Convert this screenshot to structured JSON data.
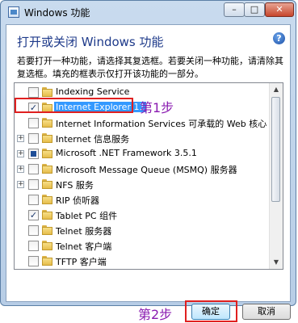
{
  "window": {
    "title": "Windows 功能",
    "controls": {
      "minimize": "–",
      "maximize": "□",
      "close": "✕"
    }
  },
  "dialog": {
    "heading": "打开或关闭 Windows 功能",
    "help_icon": "?",
    "description": "若要打开一种功能，请选择其复选框。若要关闭一种功能，请清除其复选框。填充的框表示仅打开该功能的一部分。"
  },
  "features": [
    {
      "label": "Indexing Service",
      "expandable": false,
      "state": "unchecked"
    },
    {
      "label": "Internet Explorer 11",
      "expandable": false,
      "state": "checked",
      "selected": true
    },
    {
      "label": "Internet Information Services 可承载的 Web 核心",
      "expandable": false,
      "state": "unchecked"
    },
    {
      "label": "Internet 信息服务",
      "expandable": true,
      "state": "unchecked"
    },
    {
      "label": "Microsoft .NET Framework 3.5.1",
      "expandable": true,
      "state": "partial"
    },
    {
      "label": "Microsoft Message Queue (MSMQ) 服务器",
      "expandable": true,
      "state": "unchecked"
    },
    {
      "label": "NFS 服务",
      "expandable": true,
      "state": "unchecked"
    },
    {
      "label": "RIP 侦听器",
      "expandable": false,
      "state": "unchecked"
    },
    {
      "label": "Tablet PC 组件",
      "expandable": false,
      "state": "checked"
    },
    {
      "label": "Telnet 服务器",
      "expandable": false,
      "state": "unchecked"
    },
    {
      "label": "Telnet 客户端",
      "expandable": false,
      "state": "unchecked"
    },
    {
      "label": "TFTP 客户端",
      "expandable": false,
      "state": "unchecked"
    },
    {
      "label": "Windows Process Activation Service",
      "expandable": true,
      "state": "unchecked"
    }
  ],
  "annotations": {
    "step1": "第1步",
    "step2": "第2步"
  },
  "buttons": {
    "ok": "确定",
    "cancel": "取消"
  },
  "colors": {
    "annotation": "#8a1bb0",
    "highlight_border": "#e02020",
    "selection": "#3399ff"
  }
}
